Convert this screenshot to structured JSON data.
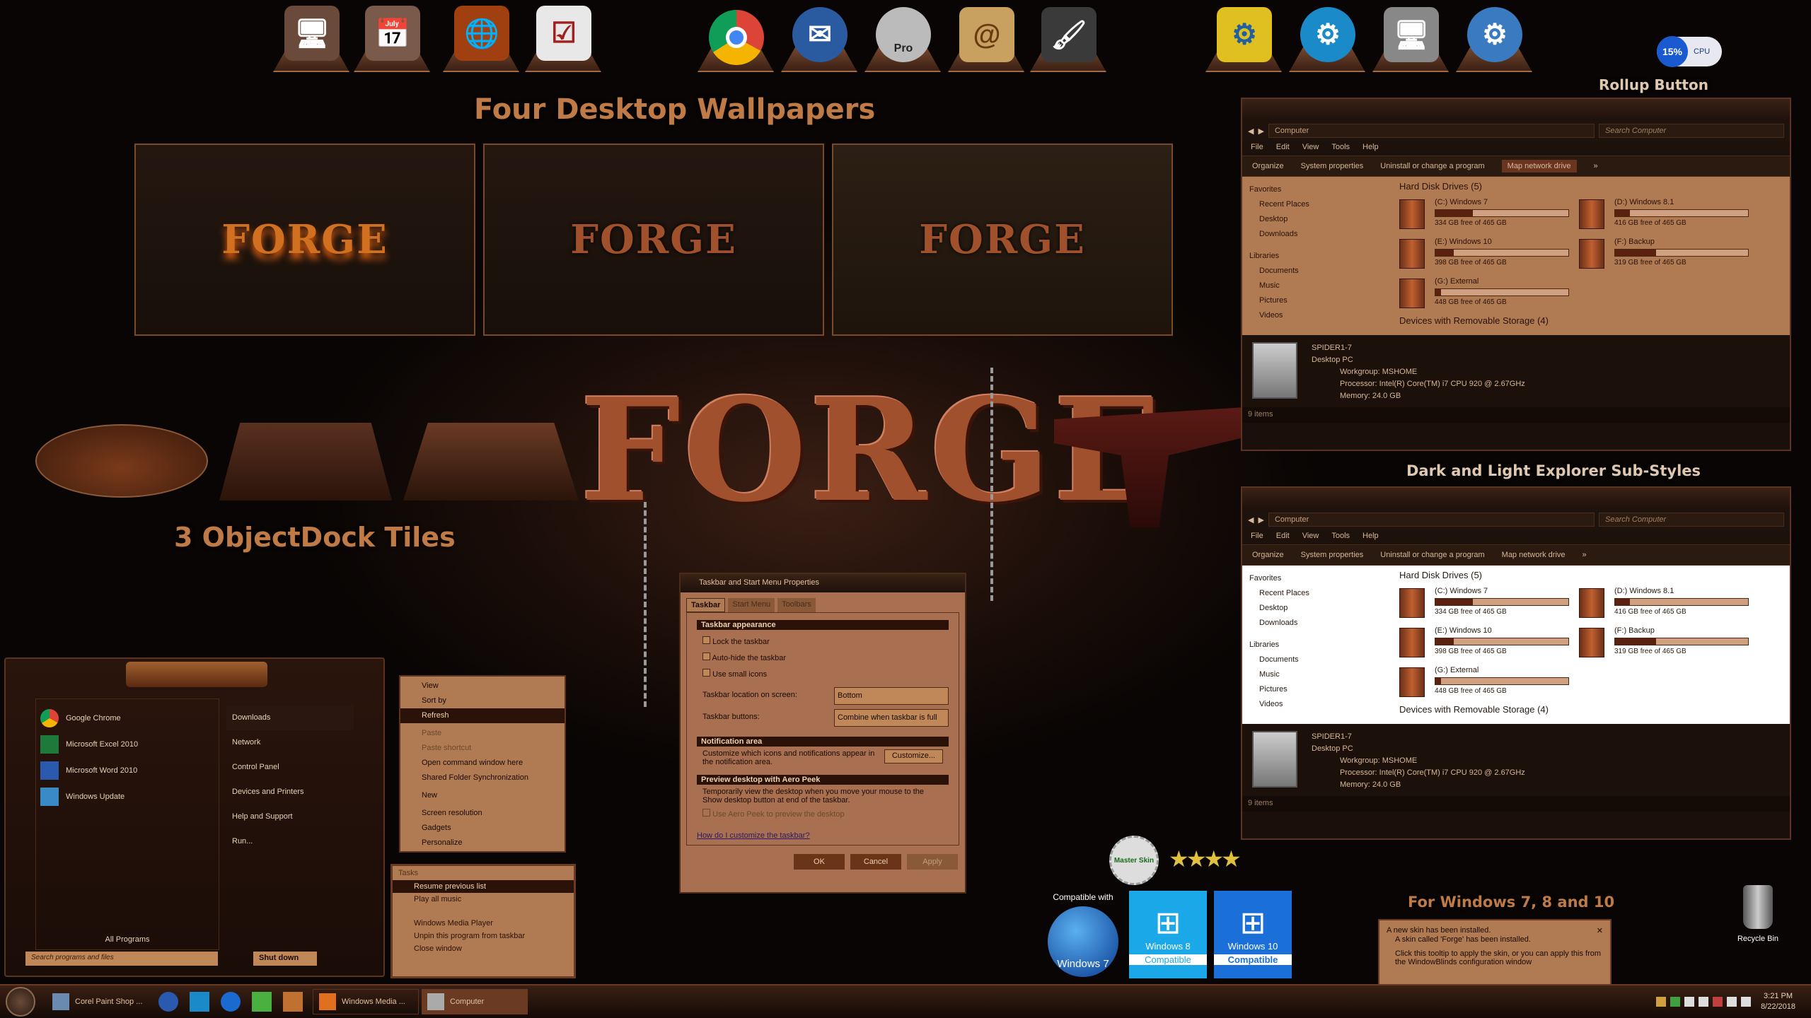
{
  "headings": {
    "wallpapers": "Four Desktop Wallpapers",
    "tiles": "3 ObjectDock Tiles",
    "rollup": "Rollup Button",
    "substyles": "Dark and Light Explorer Sub-Styles",
    "windows": "For Windows 7, 8 and 10"
  },
  "wallpaper_logo": "FORGE",
  "big_logo": "FORGE",
  "cpu": {
    "value": "15%",
    "label": "CPU"
  },
  "dock": {
    "pro_label": "Pro"
  },
  "explorer": {
    "address": "Computer",
    "search": "Search Computer",
    "menu": [
      "File",
      "Edit",
      "View",
      "Tools",
      "Help"
    ],
    "commands": [
      "Organize",
      "System properties",
      "Uninstall or change a program",
      "Map network drive",
      "»"
    ],
    "nav": [
      "Favorites",
      "Recent Places",
      "Desktop",
      "Downloads",
      "Libraries",
      "Documents",
      "Music",
      "Pictures",
      "Videos"
    ],
    "group1": "Hard Disk Drives (5)",
    "drives": [
      {
        "name": "(C:) Windows 7",
        "free": "334 GB free of 465 GB",
        "used": 0.28
      },
      {
        "name": "(D:) Windows 8.1",
        "free": "416 GB free of 465 GB",
        "used": 0.11
      },
      {
        "name": "(E:) Windows 10",
        "free": "398 GB free of 465 GB",
        "used": 0.14
      },
      {
        "name": "(F:) Backup",
        "free": "319 GB free of 465 GB",
        "used": 0.31
      },
      {
        "name": "(G:) External",
        "free": "448 GB free of 465 GB",
        "used": 0.04
      }
    ],
    "group2": "Devices with Removable Storage (4)",
    "pc": "SPIDER1-7",
    "pc_type": "Desktop PC",
    "workgroup_label": "Workgroup:",
    "workgroup": "MSHOME",
    "processor_label": "Processor:",
    "processor": "Intel(R) Core(TM) i7 CPU      920  @ 2.67GHz",
    "memory_label": "Memory:",
    "memory": "24.0 GB",
    "status": "9 items"
  },
  "startmenu": {
    "left": [
      "Google Chrome",
      "Microsoft Excel 2010",
      "Microsoft Word 2010",
      "Windows Update"
    ],
    "right": [
      "Downloads",
      "Network",
      "Control Panel",
      "Devices and Printers",
      "Help and Support",
      "Run..."
    ],
    "all_programs": "All Programs",
    "search": "Search programs and files",
    "shutdown": "Shut down"
  },
  "context": [
    "View",
    "Sort by",
    "Refresh",
    "Paste",
    "Paste shortcut",
    "Open command window here",
    "Shared Folder Synchronization",
    "New",
    "Screen resolution",
    "Gadgets",
    "Personalize"
  ],
  "jumplist": {
    "title": "Tasks",
    "tasks": [
      "Resume previous list",
      "Play all music"
    ],
    "items": [
      "Windows Media Player",
      "Unpin this program from taskbar",
      "Close window"
    ]
  },
  "dialog": {
    "title": "Taskbar and Start Menu Properties",
    "tabs": [
      "Taskbar",
      "Start Menu",
      "Toolbars"
    ],
    "sec1": "Taskbar appearance",
    "checks": [
      "Lock the taskbar",
      "Auto-hide the taskbar",
      "Use small icons"
    ],
    "loc_label": "Taskbar location on screen:",
    "loc_val": "Bottom",
    "btn_label": "Taskbar buttons:",
    "btn_val": "Combine when taskbar is full",
    "sec2": "Notification area",
    "notif_text": "Customize which icons and notifications appear in the notification area.",
    "customize": "Customize...",
    "sec3": "Preview desktop with Aero Peek",
    "peek_text": "Temporarily view the desktop when you move your mouse to the Show desktop button at end of the taskbar.",
    "peek_check": "Use Aero Peek to preview the desktop",
    "link": "How do I customize the taskbar?",
    "ok": "OK",
    "cancel": "Cancel",
    "apply": "Apply"
  },
  "badges": {
    "master": "Master Skin",
    "compat": "Compatible with",
    "win7": "Windows 7",
    "win8": "Windows 8",
    "win10": "Windows 10",
    "compatible": "Compatible"
  },
  "toast": {
    "title": "A new skin has been installed.",
    "line1": "A skin called 'Forge' has been installed.",
    "line2": "Click this tooltip to apply the skin, or you can apply this from the WindowBlinds configuration window"
  },
  "recycle": "Recycle Bin",
  "taskbar": {
    "items": [
      "Corel Paint Shop ...",
      "Windows Media ...",
      "Computer"
    ],
    "time": "3:21 PM",
    "date": "8/22/2018"
  },
  "colors": {
    "accent": "#c07a45",
    "panel": "#b07a52",
    "dark": "#1a0f0a"
  }
}
